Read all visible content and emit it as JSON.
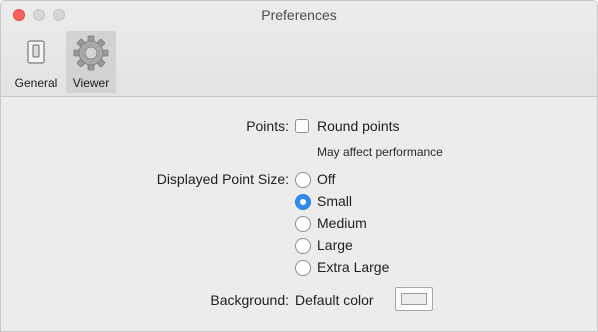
{
  "window": {
    "title": "Preferences",
    "colors": {
      "close": "#fc605c",
      "accent": "#2f8cf0"
    }
  },
  "toolbar": {
    "items": [
      {
        "label": "General",
        "icon": "switch-icon",
        "selected": false
      },
      {
        "label": "Viewer",
        "icon": "gear-icon",
        "selected": true
      }
    ]
  },
  "points": {
    "label": "Points:",
    "checkbox_label": "Round points",
    "checked": false,
    "hint": "May affect performance"
  },
  "point_size": {
    "label": "Displayed Point Size:",
    "options": [
      "Off",
      "Small",
      "Medium",
      "Large",
      "Extra Large"
    ],
    "selected": "Small"
  },
  "background": {
    "label": "Background:",
    "value_label": "Default color"
  }
}
